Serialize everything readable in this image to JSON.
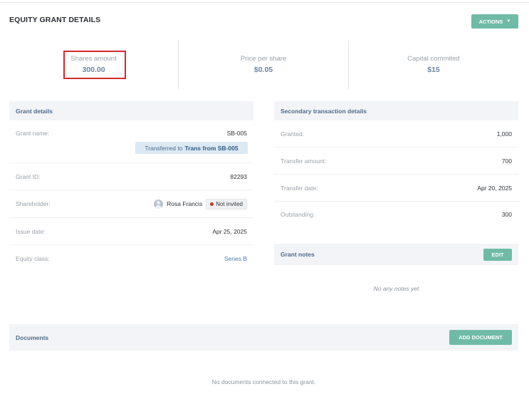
{
  "page": {
    "title": "EQUITY GRANT DETAILS"
  },
  "header": {
    "actions_label": "ACTIONS",
    "actions_icon": "caret-down-icon"
  },
  "stats": [
    {
      "label": "Shares amount",
      "value": "300.00"
    },
    {
      "label": "Price per share",
      "value": "$0.05"
    },
    {
      "label": "Capital commited",
      "value": "$15"
    }
  ],
  "grant_details": {
    "title": "Grant details",
    "grant_name": {
      "label": "Grant name:",
      "value": "SB-005"
    },
    "transfer_tag": {
      "prefix": "Transferred to",
      "link": "Trans from SB-005"
    },
    "grant_id": {
      "label": "Grant ID:",
      "value": "82293"
    },
    "shareholder": {
      "label": "Shareholder:",
      "name": "Rosa Francis",
      "badge": "Not invited"
    },
    "issue_date": {
      "label": "Issue date:",
      "value": "Apr 25, 2025"
    },
    "equity_class": {
      "label": "Equity class:",
      "value": "Series B"
    }
  },
  "secondary": {
    "title": "Secondary transaction details",
    "granted": {
      "label": "Granted:",
      "value": "1,000"
    },
    "transfer_amount": {
      "label": "Transfer amount:",
      "value": "700"
    },
    "transfer_date": {
      "label": "Transfer date:",
      "value": "Apr 20, 2025"
    },
    "outstanding": {
      "label": "Outstanding:",
      "value": "300"
    }
  },
  "grant_notes": {
    "title": "Grant notes",
    "edit_label": "EDIT",
    "empty": "No any notes yet"
  },
  "documents": {
    "title": "Documents",
    "add_label": "ADD DOCUMENT",
    "empty": "No documents connected to this grant."
  },
  "colors": {
    "accent": "#6fbba7",
    "highlight": "#d32a2a",
    "panel_bg": "#f2f4f7"
  }
}
